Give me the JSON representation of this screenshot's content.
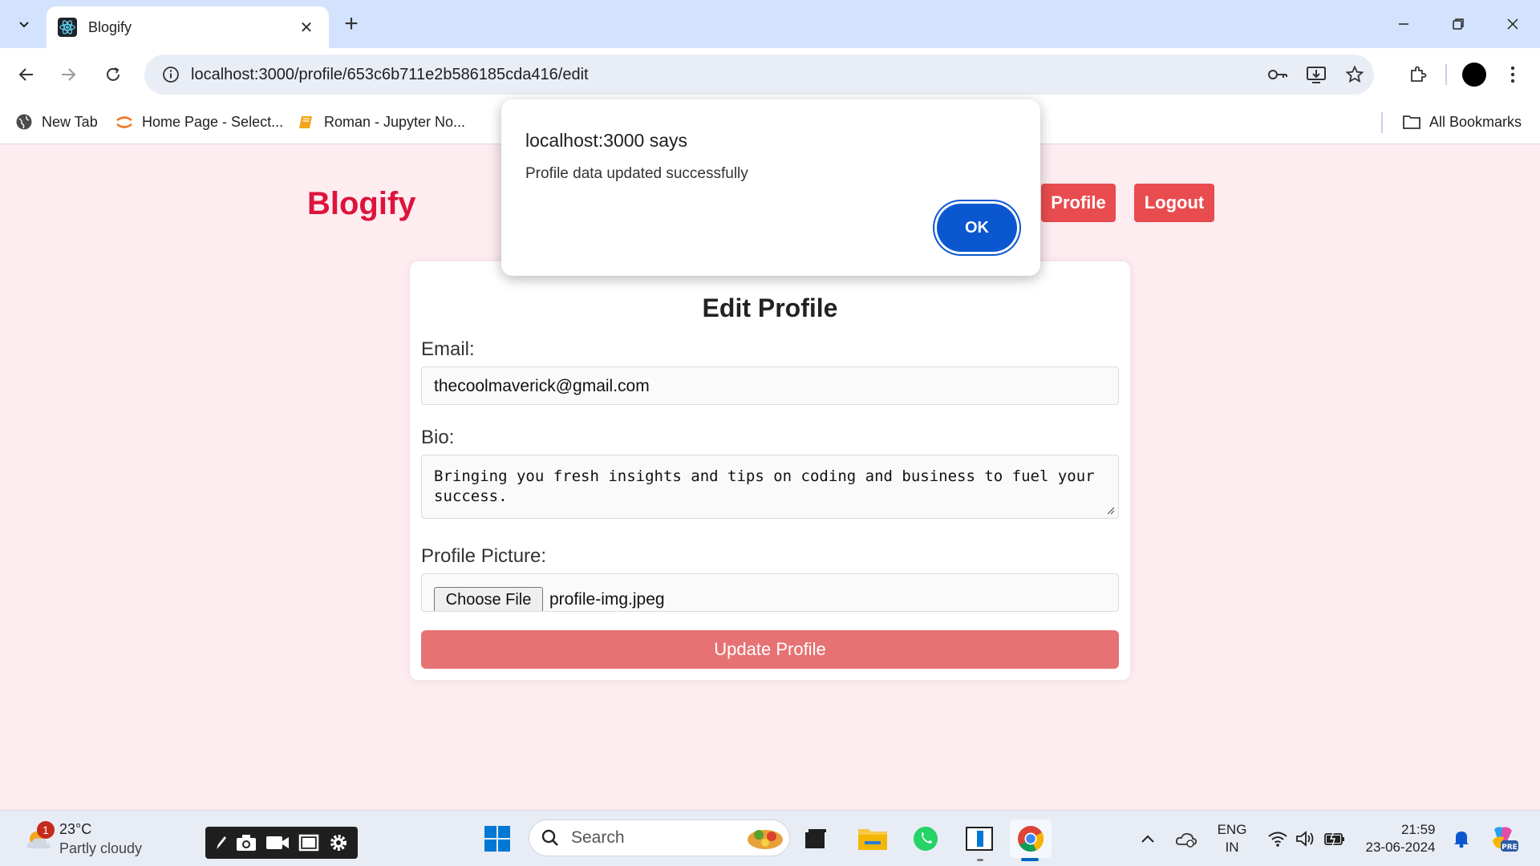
{
  "browser": {
    "tab_title": "Blogify",
    "url": "localhost:3000/profile/653c6b711e2b586185cda416/edit",
    "bookmarks": [
      {
        "label": "New Tab",
        "icon": "globe-icon"
      },
      {
        "label": "Home Page - Select...",
        "icon": "jupyter-icon"
      },
      {
        "label": "Roman - Jupyter No...",
        "icon": "notebook-icon"
      }
    ],
    "all_bookmarks_label": "All Bookmarks"
  },
  "page": {
    "brand": "Blogify",
    "nav": {
      "profile": "Profile",
      "logout": "Logout"
    },
    "form": {
      "title": "Edit Profile",
      "email_label": "Email:",
      "email_value": "thecoolmaverick@gmail.com",
      "bio_label": "Bio:",
      "bio_value": "Bringing you fresh insights and tips on coding and business to fuel your\nsuccess.",
      "picture_label": "Profile Picture:",
      "choose_file_label": "Choose File",
      "file_name": "profile-img.jpeg",
      "submit_label": "Update Profile"
    }
  },
  "dialog": {
    "title": "localhost:3000 says",
    "message": "Profile data updated successfully",
    "ok_label": "OK"
  },
  "taskbar": {
    "weather_temp": "23°C",
    "weather_condition": "Partly cloudy",
    "weather_badge": "1",
    "search_placeholder": "Search",
    "language_line1": "ENG",
    "language_line2": "IN",
    "time": "21:59",
    "date": "23-06-2024"
  },
  "colors": {
    "brand": "#dc143c",
    "nav_button": "#e84c4f",
    "submit_button": "#e77273",
    "page_bg": "#fdecf0",
    "dialog_ok": "#0b57d0"
  }
}
